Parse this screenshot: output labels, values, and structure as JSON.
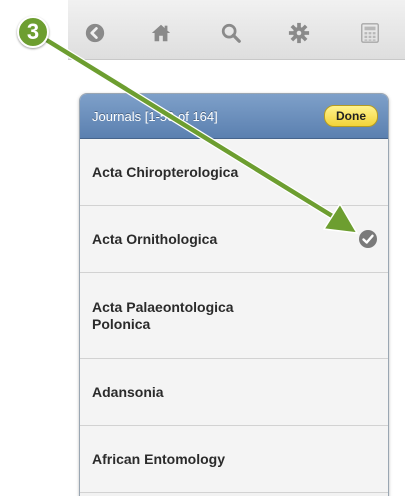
{
  "step_number": "3",
  "toolbar": {
    "icons": [
      "back-arrow-icon",
      "home-icon",
      "search-icon",
      "gear-icon",
      "calculator-icon"
    ]
  },
  "panel": {
    "title": "Journals [1-50 of 164]",
    "done_label": "Done",
    "items": [
      {
        "label": "Acta Chiropterologica",
        "checked": false
      },
      {
        "label": "Acta Ornithologica",
        "checked": true
      },
      {
        "label": "Acta Palaeontologica Polonica",
        "checked": false
      },
      {
        "label": "Adansonia",
        "checked": false
      },
      {
        "label": "African Entomology",
        "checked": false
      }
    ]
  },
  "colors": {
    "annotation": "#6d9e30",
    "header": "#5b80b0",
    "done_button": "#f2d339",
    "check": "#7a7a7a"
  }
}
